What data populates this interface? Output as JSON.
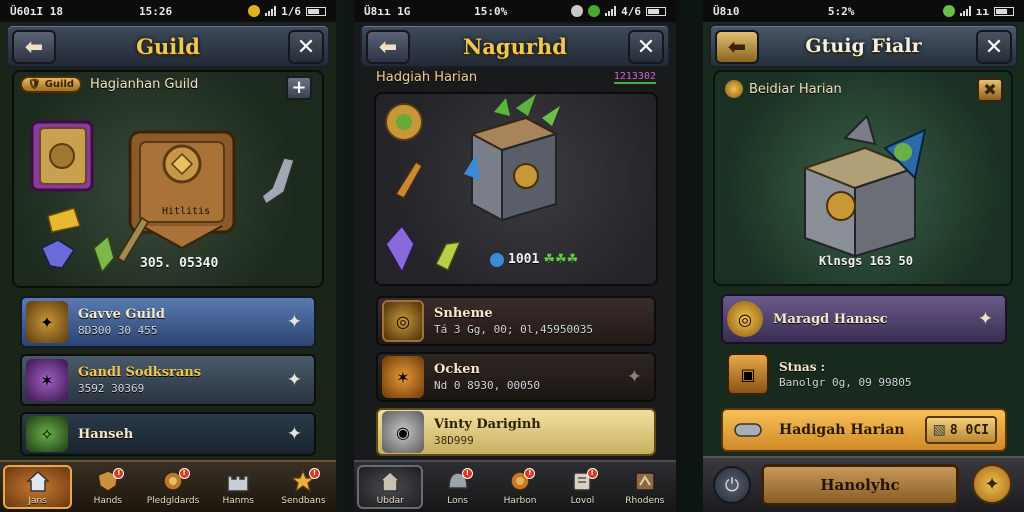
{
  "screens": [
    {
      "status": {
        "left": "Ü60ıI 18",
        "time": "15:26",
        "right": "1/6"
      },
      "header": {
        "title": "Guild",
        "back_icon": "arrow-left-icon",
        "close_icon": "close-icon"
      },
      "guild": {
        "badge": "Guild",
        "name": "Hagianhan Guild"
      },
      "chest": {
        "label": "Hitlitis",
        "amount": "305. 05340"
      },
      "rows": [
        {
          "title": "Gavve Guild",
          "sub": "8D300 30 455",
          "color": "#3a5a8a"
        },
        {
          "title": "Gandl Sodksrans",
          "sub": "3592 30369",
          "color": "#3a4a5e"
        },
        {
          "title": "Hanseh",
          "sub": "",
          "color": "#2a3a48"
        }
      ],
      "nav": [
        {
          "label": "Jans",
          "icon": "home-icon",
          "active": true,
          "badge": false
        },
        {
          "label": "Hands",
          "icon": "shield-icon",
          "active": false,
          "badge": true
        },
        {
          "label": "Pledgldards",
          "icon": "scroll-icon",
          "active": false,
          "badge": true
        },
        {
          "label": "Hanms",
          "icon": "castle-icon",
          "active": false,
          "badge": false
        },
        {
          "label": "Sendbans",
          "icon": "star-icon",
          "active": false,
          "badge": true
        }
      ]
    },
    {
      "status": {
        "left": "Ü8ıı 1G",
        "time": "15:0%",
        "right": "4/6"
      },
      "header": {
        "title": "Nagurhd",
        "back_icon": "arrow-left-icon",
        "close_icon": "close-icon"
      },
      "top": {
        "name": "Hadgiah Harian",
        "value": "1213302"
      },
      "reward": {
        "amount": "1001"
      },
      "rows": [
        {
          "title": "Snheme",
          "sub": "Tá 3 Gg, 00; 0l,45950035",
          "color": "#2c2422"
        },
        {
          "title": "Ocken",
          "sub": "Nd 0 8930, 00050",
          "color": "#2a2420"
        },
        {
          "title": "Vinty Dariginh",
          "sub": "38D999",
          "color": "#e8d890"
        }
      ],
      "nav": [
        {
          "label": "Ubdar",
          "icon": "home-icon",
          "active": true,
          "badge": false
        },
        {
          "label": "Lons",
          "icon": "helmet-icon",
          "active": false,
          "badge": true
        },
        {
          "label": "Harbon",
          "icon": "shield-icon",
          "active": false,
          "badge": true
        },
        {
          "label": "Lovol",
          "icon": "scroll-icon",
          "active": false,
          "badge": true
        },
        {
          "label": "Rhodens",
          "icon": "map-icon",
          "active": false,
          "badge": false
        }
      ]
    },
    {
      "status": {
        "left": "Ü8ı0",
        "time": "5:2%",
        "right": "ıı"
      },
      "header": {
        "title": "Gtuig Fialr",
        "back_icon": "arrow-left-icon",
        "close_icon": "close-icon"
      },
      "top": {
        "name": "Beidiar Harian"
      },
      "chest": {
        "amount": "Klnsgs 163 50"
      },
      "rows": [
        {
          "title": "Maragd Hanasc",
          "sub": "",
          "color": "#4a3a5e"
        },
        {
          "title": "Stnas :",
          "sub": "Banolgr 0g, 09 99805",
          "color": "#1e2a22"
        },
        {
          "title": "Hadigah Harian",
          "sub": "",
          "color": "#e8a040"
        }
      ],
      "row3_value": "8 0CI",
      "footer": {
        "button_label": "Hanolyhc"
      }
    }
  ]
}
